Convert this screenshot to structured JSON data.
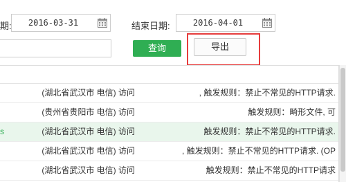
{
  "filters": {
    "start_label_partial": "期:",
    "start_date": "2016-03-31",
    "end_label": "结束日期:",
    "end_date": "2016-04-01",
    "keyword_value": "",
    "query_button": "查询",
    "export_button": "导出"
  },
  "table": {
    "rows": [
      {
        "lead": "",
        "location": "(湖北省武汉市 电信) 访问",
        "rule": ", 触发规则：禁止不常见的HTTP请求.",
        "highlight": false
      },
      {
        "lead": "",
        "location": "(贵州省贵阳市 电信) 访问",
        "rule": "触发规则：畸形文件, 可",
        "highlight": false
      },
      {
        "lead": "s",
        "location": "(湖北省武汉市 电信) 访问",
        "rule": "触发规则：禁止不常见的HTTP请求.",
        "highlight": true
      },
      {
        "lead": "",
        "location": "(湖北省武汉市 电信) 访问",
        "rule": ", 触发规则：禁止不常见的HTTP请求. (OP",
        "highlight": false
      },
      {
        "lead": "",
        "location": "(湖北省武汉市 电信) 访问",
        "rule": "触发规则：禁止不常见的HTTP请求",
        "highlight": false
      }
    ]
  },
  "colors": {
    "accent_green": "#2fae53",
    "highlight_red": "#e63c3c",
    "row_highlight": "#e9f6ec"
  },
  "icons": {
    "start_calendar": "calendar-icon",
    "end_calendar": "calendar-icon"
  }
}
